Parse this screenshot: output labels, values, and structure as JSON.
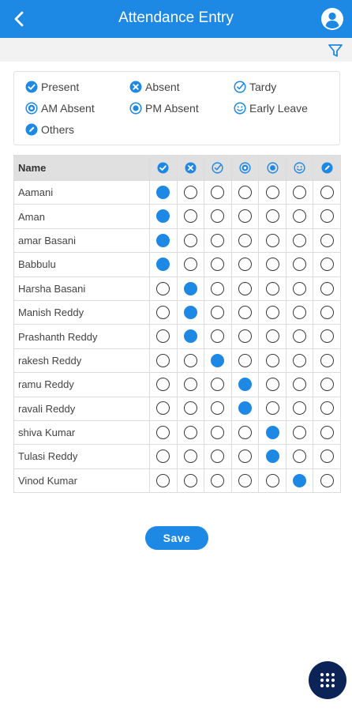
{
  "header": {
    "title": "Attendance Entry"
  },
  "legend": [
    {
      "key": "present",
      "label": "Present",
      "icon": "check-circle-icon"
    },
    {
      "key": "absent",
      "label": "Absent",
      "icon": "x-circle-icon"
    },
    {
      "key": "tardy",
      "label": "Tardy",
      "icon": "check-outline-icon"
    },
    {
      "key": "am_absent",
      "label": "AM Absent",
      "icon": "am-absent-icon"
    },
    {
      "key": "pm_absent",
      "label": "PM Absent",
      "icon": "radio-on-icon"
    },
    {
      "key": "early_leave",
      "label": "Early Leave",
      "icon": "smiley-icon"
    },
    {
      "key": "others",
      "label": "Others",
      "icon": "pencil-circle-icon"
    }
  ],
  "table": {
    "name_header": "Name",
    "statuses": [
      "present",
      "absent",
      "tardy",
      "am_absent",
      "pm_absent",
      "early_leave",
      "others"
    ],
    "students": [
      {
        "name": "Aamani",
        "status": "present"
      },
      {
        "name": "Aman",
        "status": "present"
      },
      {
        "name": "amar Basani",
        "status": "present"
      },
      {
        "name": "Babbulu",
        "status": "present"
      },
      {
        "name": "Harsha Basani",
        "status": "absent"
      },
      {
        "name": "Manish Reddy",
        "status": "absent"
      },
      {
        "name": "Prashanth Reddy",
        "status": "absent"
      },
      {
        "name": "rakesh Reddy",
        "status": "tardy"
      },
      {
        "name": "ramu Reddy",
        "status": "am_absent"
      },
      {
        "name": "ravali Reddy",
        "status": "am_absent"
      },
      {
        "name": "shiva Kumar",
        "status": "pm_absent"
      },
      {
        "name": "Tulasi Reddy",
        "status": "pm_absent"
      },
      {
        "name": "Vinod Kumar",
        "status": "early_leave"
      }
    ]
  },
  "save_label": "Save",
  "colors": {
    "primary": "#1e88e5",
    "fab": "#0b2356",
    "header_row": "#e0e0e0",
    "filter_bar": "#f2f2f2"
  }
}
